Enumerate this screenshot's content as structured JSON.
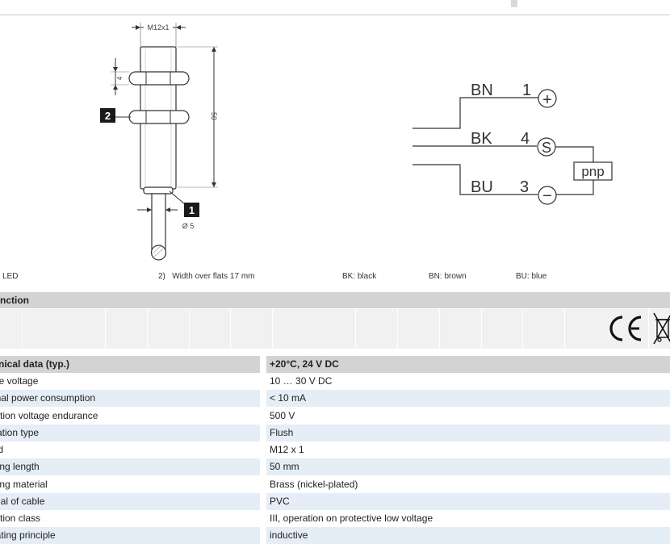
{
  "drawing": {
    "thread_label": "M12x1",
    "dim_nut": "4",
    "dim_length": "50",
    "dim_cable": "Ø 5",
    "callout_1": "1",
    "callout_2": "2"
  },
  "wiring": {
    "wires": [
      {
        "color": "BN",
        "pin": "1",
        "symbol": "+"
      },
      {
        "color": "BK",
        "pin": "4",
        "symbol": "S"
      },
      {
        "color": "BU",
        "pin": "3",
        "symbol": "−"
      }
    ],
    "output_type": "pnp"
  },
  "legend": {
    "note1": "LED",
    "note2": "2)   Width over flats 17 mm",
    "bk": "BK: black",
    "bn": "BN: brown",
    "bu": "BU: blue"
  },
  "function_section": {
    "title": "nction",
    "certifications": [
      "CE",
      "WEEE"
    ]
  },
  "technical_table": {
    "header_key": "chnical data (typ.)",
    "header_value": "+20°C, 24 V DC",
    "rows": [
      {
        "key": "vice voltage",
        "value": "10 … 30 V DC"
      },
      {
        "key": "ernal power consumption",
        "value": "< 10 mA"
      },
      {
        "key": "ulation voltage endurance",
        "value": "500 V"
      },
      {
        "key": "allation type",
        "value": "Flush"
      },
      {
        "key": "ead",
        "value": "M12 x 1"
      },
      {
        "key": "using length",
        "value": "50 mm"
      },
      {
        "key": "using material",
        "value": "Brass (nickel-plated)"
      },
      {
        "key": "terial of cable",
        "value": "PVC"
      },
      {
        "key": "tection class",
        "value": "III, operation on protective low voltage"
      },
      {
        "key": "erating principle",
        "value": "inductive"
      }
    ]
  }
}
